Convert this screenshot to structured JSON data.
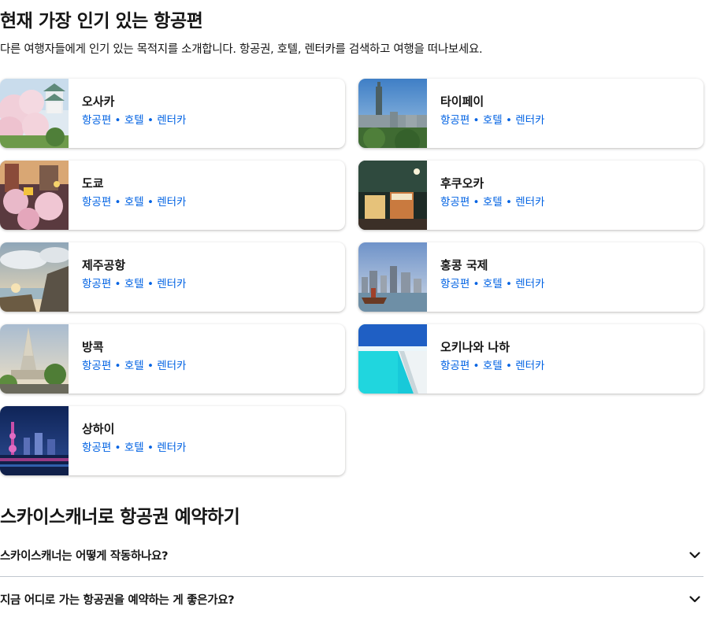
{
  "popular": {
    "title": "현재 가장 인기 있는 항공편",
    "subtitle": "다른 여행자들에게 인기 있는 목적지를 소개합니다. 항공권, 호텔, 렌터카를 검색하고 여행을 떠나보세요.",
    "link_labels": {
      "flights": "항공편",
      "hotels": "호텔",
      "cars": "렌터카",
      "separator": " • "
    },
    "cities": [
      {
        "name": "오사카"
      },
      {
        "name": "타이페이"
      },
      {
        "name": "도쿄"
      },
      {
        "name": "후쿠오카"
      },
      {
        "name": "제주공항"
      },
      {
        "name": "홍콩 국제"
      },
      {
        "name": "방콕"
      },
      {
        "name": "오키나와 나하"
      },
      {
        "name": "상하이"
      }
    ]
  },
  "booking": {
    "title": "스카이스캐너로 항공권 예약하기",
    "faqs": [
      {
        "question": "스카이스캐너는 어떻게 작동하나요?"
      },
      {
        "question": "지금 어디로 가는 항공권을 예약하는 게 좋은가요?"
      }
    ]
  },
  "colors": {
    "link": "#0062e3",
    "text": "#161616",
    "divider": "#c1c7cf"
  },
  "icons": {
    "faq_toggle": "chevron-down-icon"
  }
}
